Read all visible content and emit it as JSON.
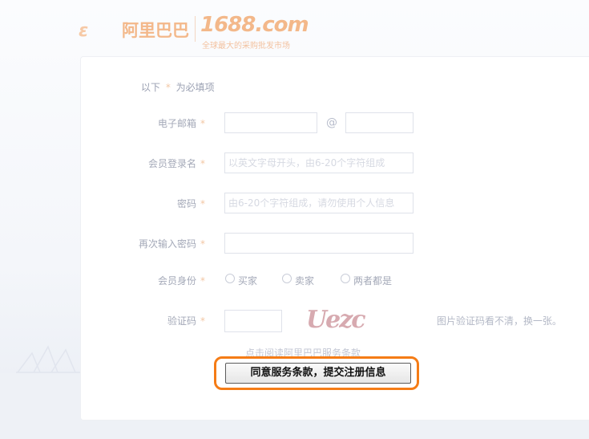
{
  "header": {
    "logo_mark": "ε",
    "brand_ali": "阿里巴巴",
    "brand_1688": "1688.com",
    "slogan": "全球最大的采购批发市场"
  },
  "form": {
    "required_note_prefix": "以下",
    "required_star": "*",
    "required_note_suffix": "为必填项",
    "email": {
      "label": "电子邮箱",
      "at": "@"
    },
    "username": {
      "label": "会员登录名",
      "placeholder": "以英文字母开头，由6-20个字符组成"
    },
    "password": {
      "label": "密码",
      "placeholder": "由6-20个字符组成，请勿使用个人信息"
    },
    "confirm_password": {
      "label": "再次输入密码"
    },
    "identity": {
      "label": "会员身份",
      "options": [
        "买家",
        "卖家",
        "两者都是"
      ]
    },
    "captcha": {
      "label": "验证码",
      "image_text": "Uezc",
      "refresh_text": "图片验证码看不清，换一张。"
    },
    "terms_link": "点击阅读阿里巴巴服务条款",
    "submit_label": "同意服务条款，提交注册信息"
  },
  "colors": {
    "highlight_border": "#f57c16",
    "required_star": "#f3c7a4"
  }
}
